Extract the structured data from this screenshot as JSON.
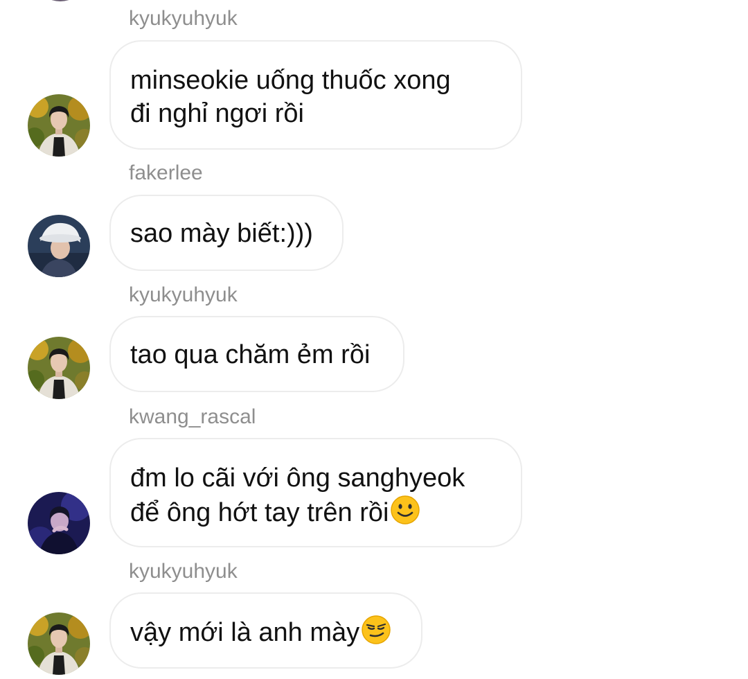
{
  "thread": {
    "messages": [
      {
        "username": "kyukyuhyuk",
        "text": "minseokie uống thuốc xong\nđi nghỉ ngơi rồi",
        "avatar": "kyukyuhyuk-avatar"
      },
      {
        "username": "fakerlee",
        "text": "sao mày biết:)))",
        "avatar": "fakerlee-avatar"
      },
      {
        "username": "kyukyuhyuk",
        "text": "tao qua chăm ẻm rồi",
        "avatar": "kyukyuhyuk-avatar"
      },
      {
        "username": "kwang_rascal",
        "text": "đm lo cãi với ông sanghyeok\nđể ông hớt tay trên rồi",
        "emoji": "slightly-smiling-face",
        "avatar": "kwang_rascal-avatar"
      },
      {
        "username": "kyukyuhyuk",
        "text": "vậy mới là anh mày",
        "emoji": "smirking-face",
        "avatar": "kyukyuhyuk-avatar"
      }
    ]
  },
  "colors": {
    "username_text": "#8e8e8e",
    "message_text": "#111111",
    "bubble_border": "#ececec",
    "background": "#ffffff"
  }
}
